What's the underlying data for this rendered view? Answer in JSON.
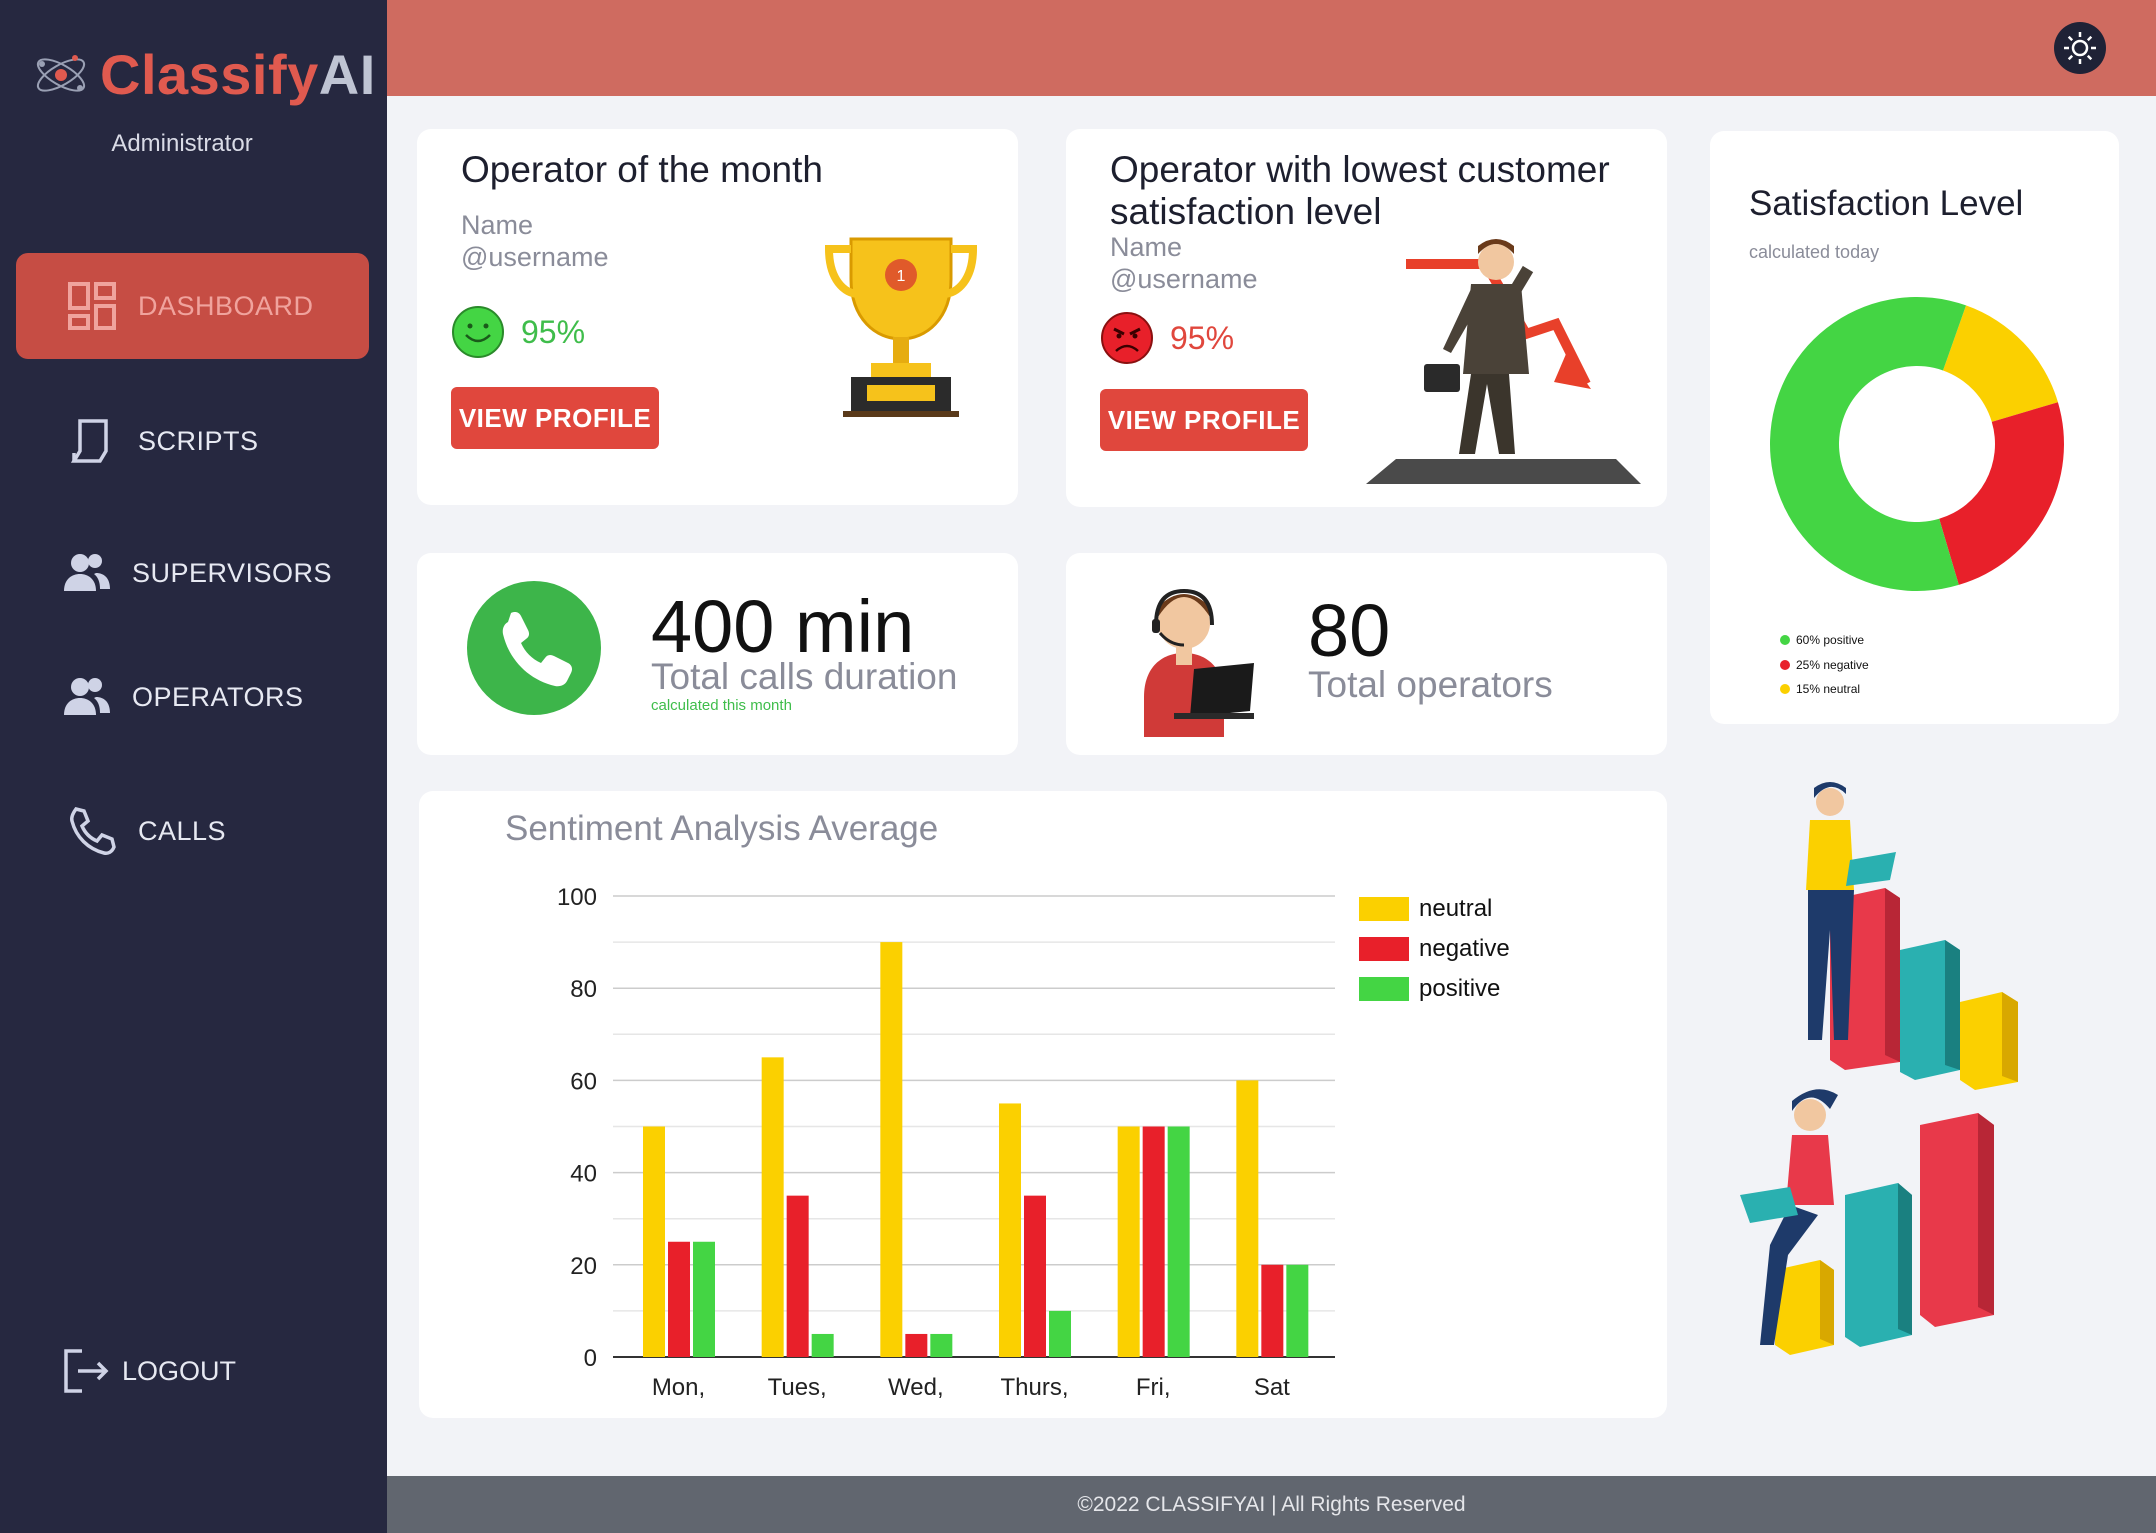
{
  "brand": {
    "part1": "Classify",
    "part2": "AI",
    "role": "Administrator"
  },
  "nav": {
    "dashboard": "DASHBOARD",
    "scripts": "SCRIPTS",
    "supervisors": "SUPERVISORS",
    "operators": "OPERATORS",
    "calls": "CALLS",
    "logout": "LOGOUT"
  },
  "operator_month": {
    "title": "Operator of the month",
    "name": "Name",
    "username": "@username",
    "percent": "95%",
    "button": "VIEW PROFILE"
  },
  "operator_low": {
    "title_line1": "Operator with lowest customer",
    "title_line2": "satisfaction level",
    "name": "Name",
    "username": "@username",
    "percent": "95%",
    "button": "VIEW PROFILE"
  },
  "satisfaction": {
    "title": "Satisfaction Level",
    "subtitle": "calculated today",
    "legend": [
      "60% positive",
      "25% negative",
      "15% neutral"
    ]
  },
  "calls": {
    "value": "400 min",
    "label": "Total calls duration",
    "note": "calculated this month"
  },
  "operators_total": {
    "value": "80",
    "label": "Total operators"
  },
  "colors": {
    "positive": "#44d544",
    "negative": "#e8202a",
    "neutral": "#fbd000",
    "accent": "#e0473d",
    "sidebar": "#262840"
  },
  "chart_data": [
    {
      "type": "pie",
      "title": "Satisfaction Level",
      "categories": [
        "positive",
        "negative",
        "neutral"
      ],
      "values": [
        60,
        25,
        15
      ]
    },
    {
      "type": "bar",
      "title": "Sentiment Analysis Average",
      "categories": [
        "Mon,",
        "Tues,",
        "Wed,",
        "Thurs,",
        "Fri,",
        "Sat"
      ],
      "series": [
        {
          "name": "neutral",
          "values": [
            50,
            65,
            90,
            55,
            50,
            60
          ]
        },
        {
          "name": "negative",
          "values": [
            25,
            35,
            5,
            35,
            50,
            20
          ]
        },
        {
          "name": "positive",
          "values": [
            25,
            5,
            5,
            10,
            50,
            20
          ]
        }
      ],
      "yticks": [
        0,
        20,
        40,
        60,
        80,
        100
      ],
      "ylim": [
        0,
        100
      ],
      "grid": true,
      "legend_position": "right"
    }
  ],
  "footer": "©2022 CLASSIFYAI | All Rights Reserved"
}
